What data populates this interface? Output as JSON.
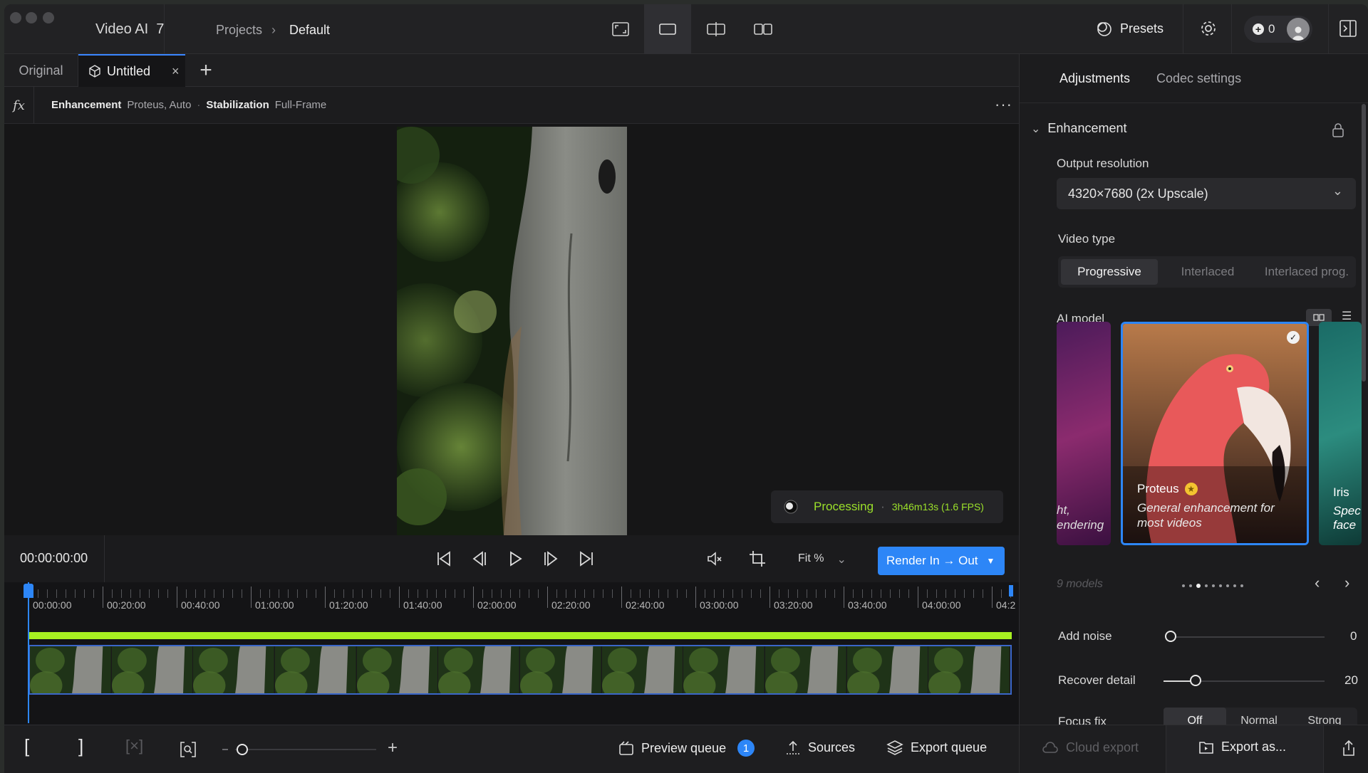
{
  "app": {
    "name": "Video AI",
    "version": "7"
  },
  "breadcrumb": {
    "root": "Projects",
    "current": "Default"
  },
  "header": {
    "presets_label": "Presets",
    "credits": "0"
  },
  "tabs": [
    {
      "label": "Original"
    },
    {
      "label": "Untitled"
    }
  ],
  "filters": {
    "fx_label": "fx",
    "items": [
      {
        "name": "Enhancement",
        "value": "Proteus, Auto"
      },
      {
        "name": "Stabilization",
        "value": "Full-Frame"
      }
    ]
  },
  "status": {
    "label": "Processing",
    "eta": "3h46m13s (1.6 FPS)"
  },
  "transport": {
    "timecode": "00:00:00:00",
    "zoom": "Fit %",
    "render_label": "Render In → Out"
  },
  "timeline": {
    "labels": [
      "00:00:00",
      "00:20:00",
      "00:40:00",
      "01:00:00",
      "01:20:00",
      "01:40:00",
      "02:00:00",
      "02:20:00",
      "02:40:00",
      "03:00:00",
      "03:20:00",
      "03:40:00",
      "04:00:00",
      "04:2"
    ]
  },
  "bottom": {
    "preview_queue": "Preview queue",
    "preview_count": "1",
    "sources": "Sources",
    "export_queue": "Export queue",
    "cloud_export": "Cloud export",
    "export_as": "Export as..."
  },
  "panel": {
    "tabs": [
      "Adjustments",
      "Codec settings"
    ],
    "section": "Enhancement",
    "output_resolution_label": "Output resolution",
    "output_resolution_value": "4320×7680 (2x Upscale)",
    "video_type_label": "Video type",
    "video_types": [
      "Progressive",
      "Interlaced",
      "Interlaced prog."
    ],
    "ai_model_label": "AI model",
    "models_left_caption": [
      "ht,",
      "endering"
    ],
    "model_selected": {
      "name": "Proteus",
      "desc": "General enhancement for most videos"
    },
    "model_right": {
      "name": "Iris",
      "desc": [
        "Spec",
        "face"
      ]
    },
    "models_count": "9 models",
    "add_noise_label": "Add noise",
    "add_noise_value": "0",
    "add_noise_level": 0,
    "recover_detail_label": "Recover detail",
    "recover_detail_value": "20",
    "recover_detail_level": 0.2,
    "focus_fix_label": "Focus fix",
    "focus_fix_options": [
      "Off",
      "Normal",
      "Strong"
    ]
  },
  "colors": {
    "accent": "#2d86f7",
    "progress": "#a7f021",
    "processing": "#9be02a"
  }
}
